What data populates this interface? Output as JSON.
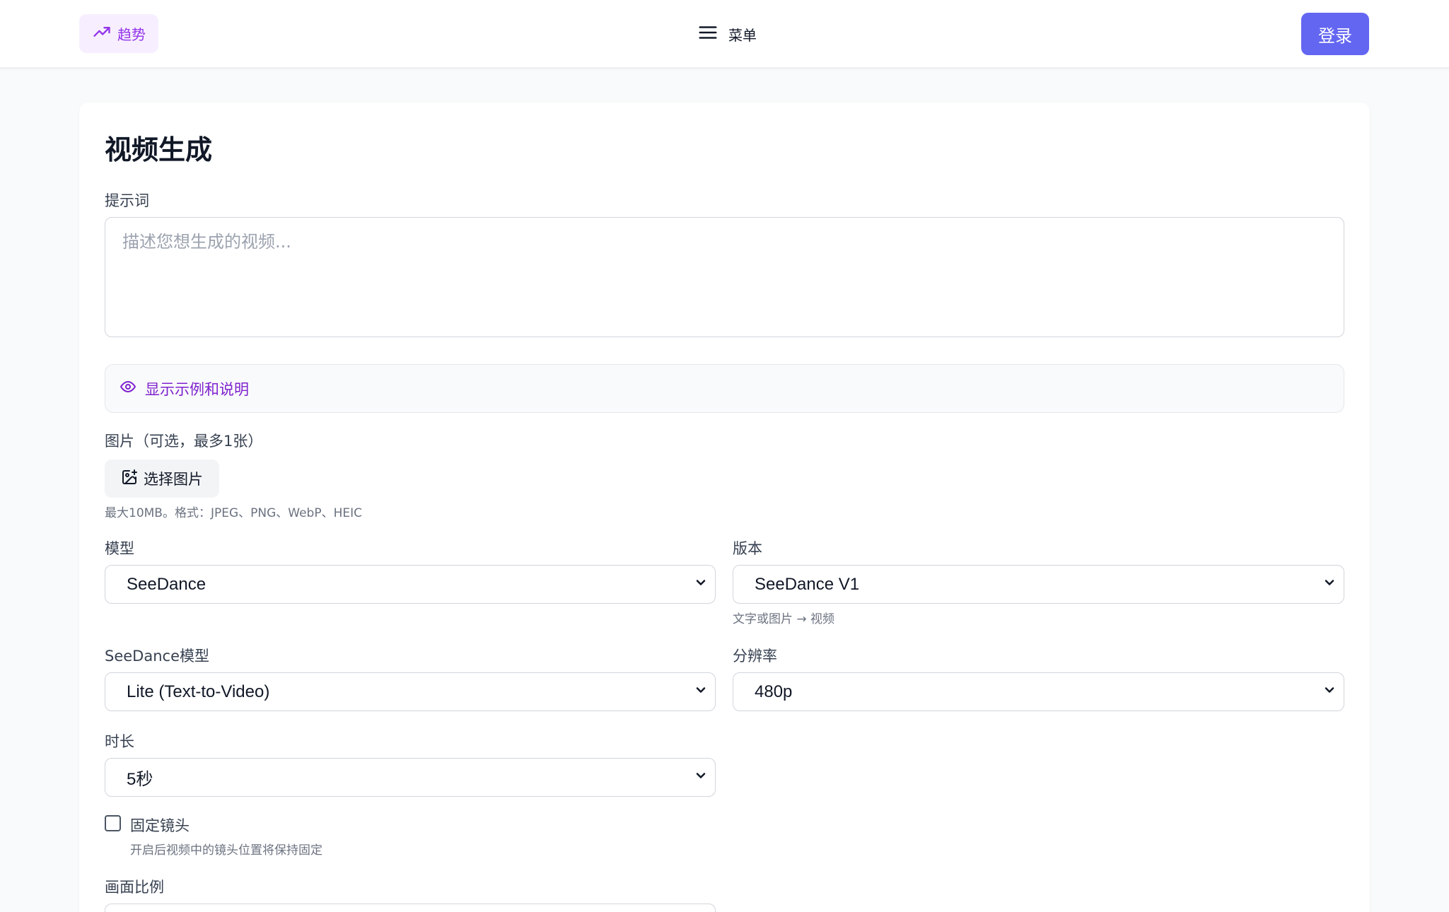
{
  "header": {
    "trend_label": "趋势",
    "menu_label": "菜单",
    "login_label": "登录"
  },
  "form": {
    "title": "视频生成",
    "prompt": {
      "label": "提示词",
      "placeholder": "描述您想生成的视频..."
    },
    "examples_label": "显示示例和说明",
    "image": {
      "label": "图片（可选，最多1张）",
      "button_label": "选择图片",
      "hint": "最大10MB。格式：JPEG、PNG、WebP、HEIC"
    },
    "model": {
      "label": "模型",
      "value": "SeeDance"
    },
    "version": {
      "label": "版本",
      "value": "SeeDance V1",
      "hint": "文字或图片 → 视频"
    },
    "seedance_model": {
      "label": "SeeDance模型",
      "value": "Lite (Text-to-Video)"
    },
    "resolution": {
      "label": "分辨率",
      "value": "480p"
    },
    "duration": {
      "label": "时长",
      "value": "5秒"
    },
    "fixed_camera": {
      "label": "固定镜头",
      "hint": "开启后视频中的镜头位置将保持固定",
      "checked": false
    },
    "aspect_ratio": {
      "label": "画面比例"
    }
  },
  "colors": {
    "accent": "#6366f1",
    "purple_text": "#9333ea",
    "trend_bg": "#f7efff"
  },
  "icons": {
    "trend": "trending-up-icon",
    "menu": "hamburger-menu-icon",
    "eye": "eye-icon",
    "image_add": "image-plus-icon",
    "chevron": "chevron-down-icon"
  }
}
